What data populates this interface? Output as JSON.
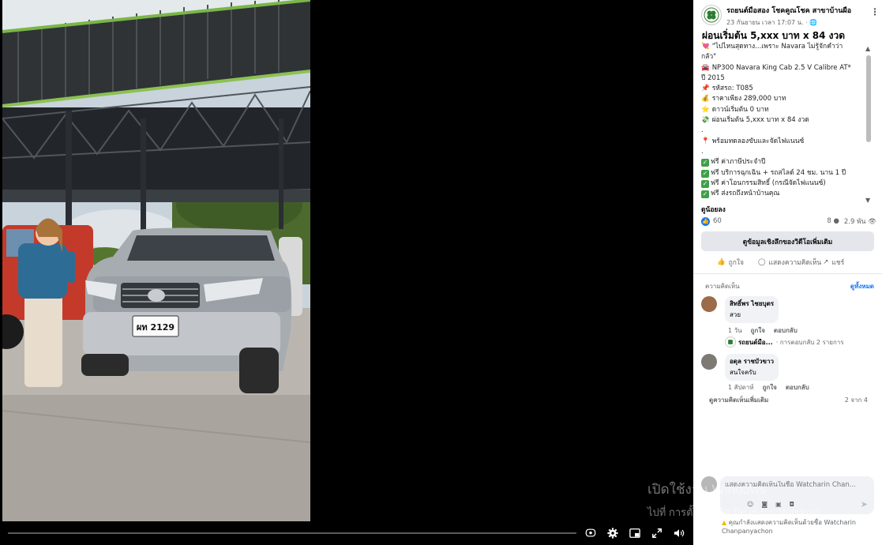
{
  "post": {
    "page_name": "รถยนต์มือสอง โชคคูณโชค สาขาบ้านผือ",
    "time": "23 กันยายน เวลา 17:07 น. · ",
    "more_icon": "more-dots-icon",
    "title": "ผ่อนเริ่มต้น 5,xxx บาท x 84 งวด",
    "body_lines": [
      {
        "emoji": "💘",
        "text": "\"ไปไหนสุดทาง...เพราะ Navara ไม่รู้จักคำว่า"
      },
      {
        "emoji": "",
        "text": "กลัว\""
      },
      {
        "emoji": "🚘",
        "text": "NP300 Navara King Cab 2.5 V Calibre AT*"
      },
      {
        "emoji": "",
        "text": "ปี 2015"
      },
      {
        "emoji": "📌",
        "text": "รหัสรถ: T085"
      },
      {
        "emoji": "💰",
        "text": "ราคาเพียง 289,000 บาท"
      },
      {
        "emoji": "⭐",
        "text": "ดาวน์เริ่มต้น 0 บาท"
      },
      {
        "emoji": "💸",
        "text": "ผ่อนเริ่มต้น 5,xxx บาท x 84 งวด"
      },
      {
        "emoji": "",
        "text": "."
      },
      {
        "emoji": "📍",
        "text": "พร้อมทดลองขับและจัดไฟแนนซ์"
      },
      {
        "emoji": "",
        "text": "."
      }
    ],
    "checklist": [
      "ฟรี ค่าภาษีประจำปี",
      "ฟรี บริการฉุกเฉิน + รถสไลด์ 24 ชม. นาน 1 ปี",
      "ฟรี ค่าโอนกรรมสิทธิ์ (กรณีจัดไฟแนนซ์)",
      "ฟรี ส่งรถถึงหน้าบ้านคุณ"
    ],
    "see_less": "ดูน้อยลง",
    "reaction_count": "60",
    "comment_stat": "8",
    "view_stat": "2.9 พัน",
    "insights_button": "ดูข้อมูลเชิงลึกของวิดีโอเพิ่มเติม",
    "like_label": "ถูกใจ",
    "comment_label": "แสดงความคิดเห็น",
    "share_label": "แชร์"
  },
  "comments": {
    "section_label": "ความคิดเห็น",
    "see_all": "ดูทั้งหมด",
    "items": [
      {
        "author": "สิทธิ์พร ไชยบุตร",
        "text": "สวย",
        "time": "1 วัน",
        "like": "ถูกใจ",
        "reply": "ตอบกลับ"
      },
      {
        "author": "อดุล ราชบัวขาว",
        "text": "สนใจครับ",
        "time": "1 สัปดาห์",
        "like": "ถูกใจ",
        "reply": "ตอบกลับ"
      }
    ],
    "reply_preview_name": "รถยนต์มือ...",
    "reply_preview_text": "· การตอบกลับ 2 รายการ",
    "more_comments": "ดูความคิดเห็นเพิ่มเติม",
    "count": "2 จาก 4"
  },
  "composer": {
    "placeholder": "แสดงความคิดเห็นในชื่อ Watcharin Chan..."
  },
  "notice": "คุณกำลังแสดงความคิดเห็นด้วยชื่อ Watcharin Chanpanyachon",
  "watermark": {
    "line1": "เปิดใช้งาน Windows",
    "line2": "ไปที่ การตั้งค่า เพื่อเปิดใช้งาน Windows"
  },
  "video": {
    "plate": "ผท 2129",
    "controls": [
      "captions-icon",
      "settings-icon",
      "picture-in-picture-icon",
      "fullscreen-icon",
      "volume-icon"
    ]
  }
}
